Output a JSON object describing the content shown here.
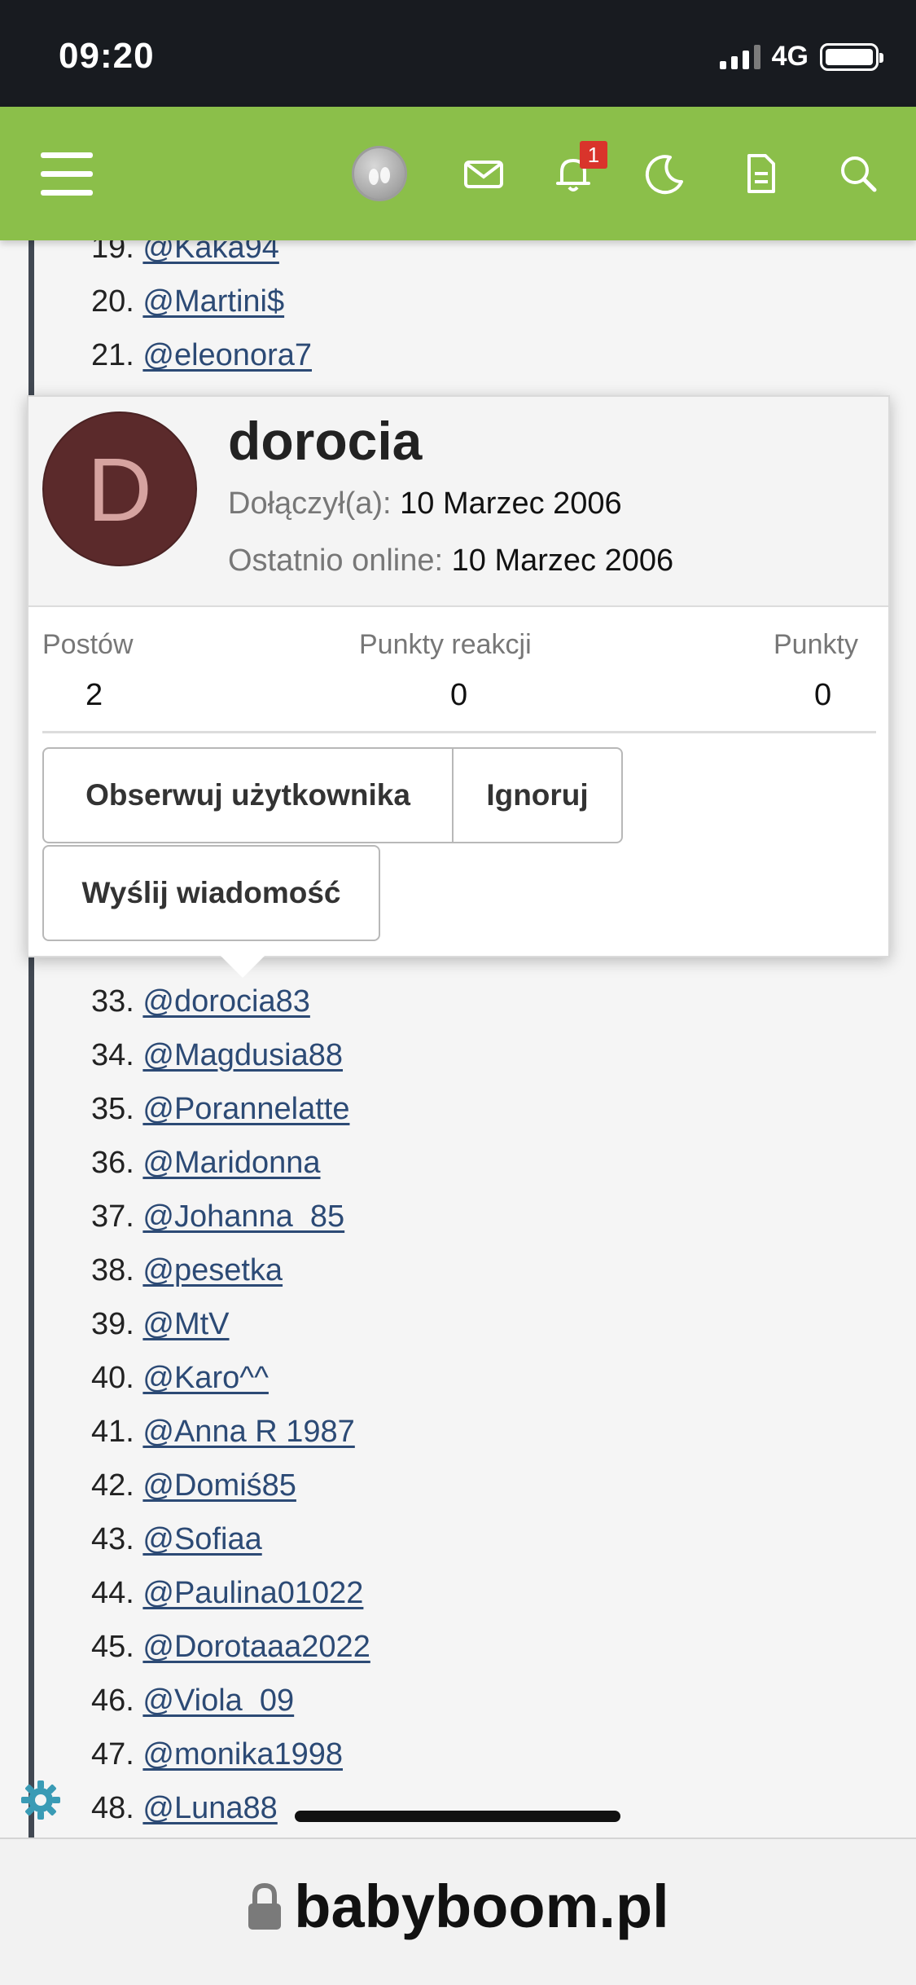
{
  "status_bar": {
    "time": "09:20",
    "network": "4G"
  },
  "header": {
    "notification_count": "1",
    "icons": [
      "menu-icon",
      "avatar",
      "envelope-icon",
      "bell-icon",
      "moon-icon",
      "document-icon",
      "search-icon"
    ]
  },
  "list_items": [
    {
      "num": "19.",
      "user": "@Kaka94"
    },
    {
      "num": "20.",
      "user": "@Martini$"
    },
    {
      "num": "21.",
      "user": "@eleonora7"
    },
    {
      "num": "33.",
      "user": "@dorocia83"
    },
    {
      "num": "34.",
      "user": "@Magdusia88"
    },
    {
      "num": "35.",
      "user": "@Porannelatte"
    },
    {
      "num": "36.",
      "user": "@Maridonna"
    },
    {
      "num": "37.",
      "user": "@Johanna_85"
    },
    {
      "num": "38.",
      "user": "@pesetka"
    },
    {
      "num": "39.",
      "user": "@MtV"
    },
    {
      "num": "40.",
      "user": "@Karo^^"
    },
    {
      "num": "41.",
      "user": "@Anna R 1987"
    },
    {
      "num": "42.",
      "user": "@Domiś85"
    },
    {
      "num": "43.",
      "user": "@Sofiaa"
    },
    {
      "num": "44.",
      "user": "@Paulina01022"
    },
    {
      "num": "45.",
      "user": "@Dorotaaa2022"
    },
    {
      "num": "46.",
      "user": "@Viola_09"
    },
    {
      "num": "47.",
      "user": "@monika1998"
    },
    {
      "num": "48.",
      "user": "@Luna88"
    }
  ],
  "member_card": {
    "avatar_letter": "D",
    "username": "dorocia",
    "joined_label": "Dołączył(a):",
    "joined_value": "10 Marzec 2006",
    "online_label": "Ostatnio online:",
    "online_value": "10 Marzec 2006",
    "stats": [
      {
        "label": "Postów",
        "value": "2"
      },
      {
        "label": "Punkty reakcji",
        "value": "0"
      },
      {
        "label": "Punkty",
        "value": "0"
      }
    ],
    "follow_label": "Obserwuj użytkownika",
    "ignore_label": "Ignoruj",
    "message_label": "Wyślij wiadomość"
  },
  "address_bar": {
    "domain": "babyboom.pl"
  },
  "colors": {
    "header_green": "#8bbf4a",
    "link": "#2c4a75",
    "avatar_bg": "#5b2a2b",
    "badge_red": "#d9342b",
    "gear_teal": "#3a9bb5"
  }
}
